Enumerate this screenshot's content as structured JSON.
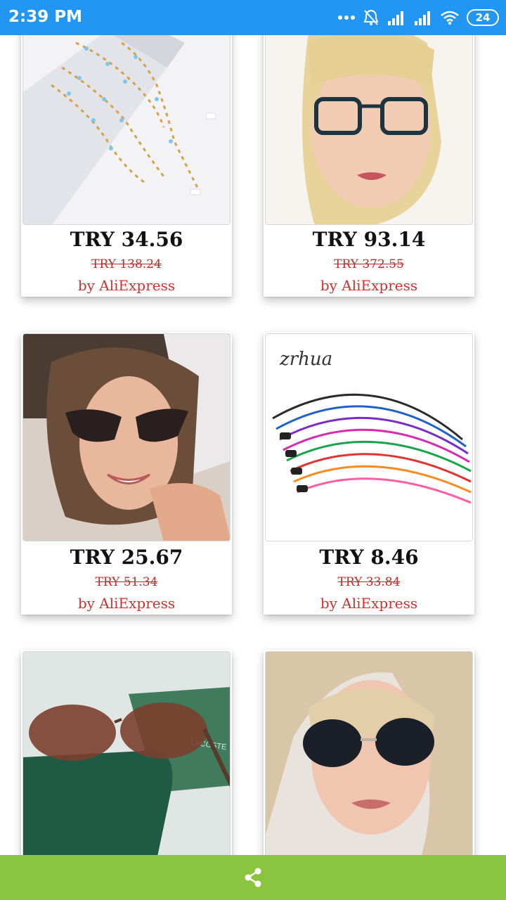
{
  "status_bar": {
    "time": "2:39 PM",
    "battery": "24"
  },
  "products": [
    {
      "price": "TRY 34.56",
      "old_price": "TRY 138.24",
      "seller": "by AliExpress",
      "image": "beaded eyeglass chain"
    },
    {
      "price": "TRY 93.14",
      "old_price": "TRY 372.55",
      "seller": "by AliExpress",
      "image": "woman wearing cat-eye glasses"
    },
    {
      "price": "TRY 25.67",
      "old_price": "TRY 51.34",
      "seller": "by AliExpress",
      "image": "woman wearing dark sunglasses"
    },
    {
      "price": "TRY 8.46",
      "old_price": "TRY 33.84",
      "seller": "by AliExpress",
      "image": "colorful glasses straps",
      "image_text": "zrhua"
    },
    {
      "image": "aviator sunglasses on case",
      "image_text": "LACOSTE"
    },
    {
      "image": "woman wearing round sunglasses"
    }
  ],
  "colors": {
    "status_bar": "#2196f3",
    "bottom_bar": "#8bc53f",
    "seller": "#d32f2f"
  },
  "bottom_bar": {
    "icon": "share-icon"
  }
}
